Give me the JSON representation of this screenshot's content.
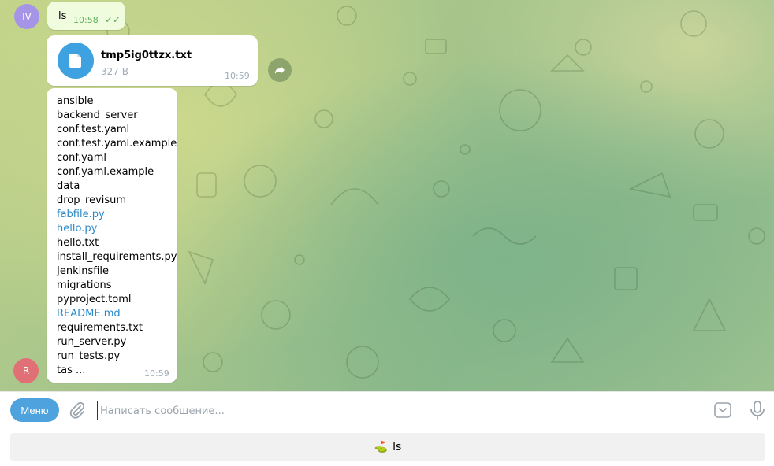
{
  "messages": {
    "ls_command": {
      "avatar_initials": "IV",
      "avatar_color": "#a695e7",
      "text": "ls",
      "time": "10:58",
      "checkmarks": "✓✓"
    },
    "file": {
      "name": "tmp5ig0ttzx.txt",
      "size": "327 B",
      "time": "10:59",
      "icon": "document-icon"
    },
    "listing": {
      "avatar_initials": "R",
      "avatar_color": "#e17076",
      "time": "10:59",
      "items": [
        {
          "text": "ansible",
          "link": false
        },
        {
          "text": "backend_server",
          "link": false
        },
        {
          "text": "conf.test.yaml",
          "link": false
        },
        {
          "text": "conf.test.yaml.example",
          "link": false
        },
        {
          "text": "conf.yaml",
          "link": false
        },
        {
          "text": "conf.yaml.example",
          "link": false
        },
        {
          "text": "data",
          "link": false
        },
        {
          "text": "drop_revisum",
          "link": false
        },
        {
          "text": "fabfile.py",
          "link": true
        },
        {
          "text": "hello.py",
          "link": true
        },
        {
          "text": "hello.txt",
          "link": false
        },
        {
          "text": "install_requirements.py",
          "link": false
        },
        {
          "text": "Jenkinsfile",
          "link": false
        },
        {
          "text": "migrations",
          "link": false
        },
        {
          "text": "pyproject.toml",
          "link": false
        },
        {
          "text": "README.md",
          "link": true
        },
        {
          "text": "requirements.txt",
          "link": false
        },
        {
          "text": "run_server.py",
          "link": false
        },
        {
          "text": "run_tests.py",
          "link": false
        },
        {
          "text": "tas ...",
          "link": false
        }
      ]
    }
  },
  "composer": {
    "menu_label": "Меню",
    "placeholder": "Написать сообщение...",
    "keyboard_button": {
      "emoji": "⛳",
      "label": "ls"
    }
  },
  "colors": {
    "accent": "#4ea2dd",
    "link": "#2a88c7",
    "file_icon_bg": "#3ea2e0"
  }
}
